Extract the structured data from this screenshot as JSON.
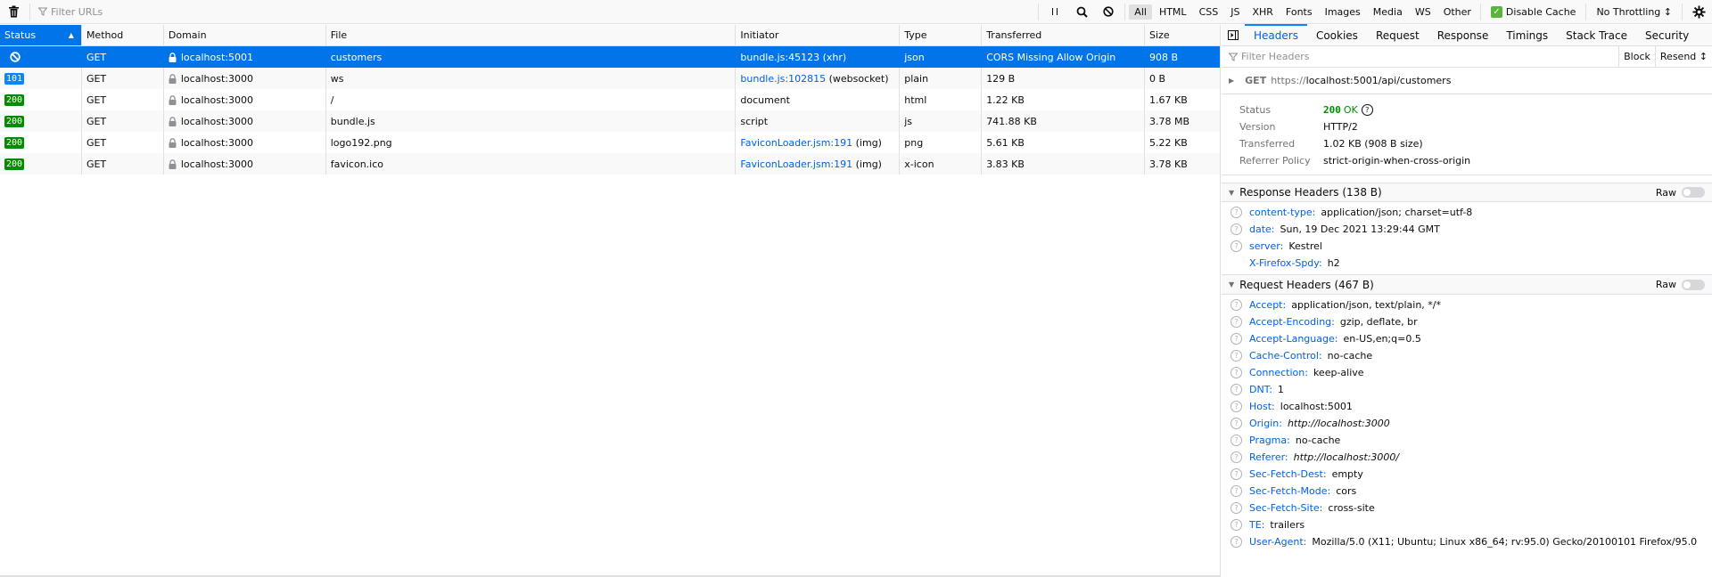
{
  "toolbar": {
    "filter_placeholder": "Filter URLs",
    "type_filters": [
      "All",
      "HTML",
      "CSS",
      "JS",
      "XHR",
      "Fonts",
      "Images",
      "Media",
      "WS",
      "Other"
    ],
    "active_filter": "All",
    "disable_cache_label": "Disable Cache",
    "disable_cache_checked": true,
    "throttling_label": "No Throttling ↕"
  },
  "table": {
    "columns": [
      "Status",
      "Method",
      "Domain",
      "File",
      "Initiator",
      "Type",
      "Transferred",
      "Size"
    ],
    "sorted_column": "Status",
    "rows": [
      {
        "status": "blocked",
        "status_color": "",
        "method": "GET",
        "domain": "localhost:5001",
        "file": "customers",
        "initiator_link": "bundle.js:45123",
        "initiator_extra": " (xhr)",
        "type": "json",
        "transferred": "CORS Missing Allow Origin",
        "size": "908 B",
        "selected": true
      },
      {
        "status": "101",
        "status_color": "#0a84ff",
        "method": "GET",
        "domain": "localhost:3000",
        "file": "ws",
        "initiator_link": "bundle.js:102815",
        "initiator_extra": " (websocket)",
        "type": "plain",
        "transferred": "129 B",
        "size": "0 B",
        "selected": false
      },
      {
        "status": "200",
        "status_color": "#058b00",
        "method": "GET",
        "domain": "localhost:3000",
        "file": "/",
        "initiator_link": "",
        "initiator_extra": "document",
        "type": "html",
        "transferred": "1.22 KB",
        "size": "1.67 KB",
        "selected": false
      },
      {
        "status": "200",
        "status_color": "#058b00",
        "method": "GET",
        "domain": "localhost:3000",
        "file": "bundle.js",
        "initiator_link": "",
        "initiator_extra": "script",
        "type": "js",
        "transferred": "741.88 KB",
        "size": "3.78 MB",
        "selected": false
      },
      {
        "status": "200",
        "status_color": "#058b00",
        "method": "GET",
        "domain": "localhost:3000",
        "file": "logo192.png",
        "initiator_link": "FaviconLoader.jsm:191",
        "initiator_extra": " (img)",
        "type": "png",
        "transferred": "5.61 KB",
        "size": "5.22 KB",
        "selected": false
      },
      {
        "status": "200",
        "status_color": "#058b00",
        "method": "GET",
        "domain": "localhost:3000",
        "file": "favicon.ico",
        "initiator_link": "FaviconLoader.jsm:191",
        "initiator_extra": " (img)",
        "type": "x-icon",
        "transferred": "3.83 KB",
        "size": "3.78 KB",
        "selected": false
      }
    ]
  },
  "panel": {
    "tabs": [
      "Headers",
      "Cookies",
      "Request",
      "Response",
      "Timings",
      "Stack Trace",
      "Security"
    ],
    "active_tab": "Headers",
    "filter_placeholder": "Filter Headers",
    "block_label": "Block",
    "resend_label": "Resend ↕",
    "request_method": "GET",
    "request_url_scheme": "https://",
    "request_url_rest": "localhost:5001/api/customers",
    "summary": {
      "status_label": "Status",
      "status_code": "200",
      "status_text": "OK",
      "version_label": "Version",
      "version": "HTTP/2",
      "transferred_label": "Transferred",
      "transferred": "1.02 KB (908 B size)",
      "referrer_label": "Referrer Policy",
      "referrer": "strict-origin-when-cross-origin"
    },
    "response_headers": {
      "title": "Response Headers (138 B)",
      "raw_label": "Raw",
      "items": [
        {
          "name": "content-type:",
          "value": "application/json; charset=utf-8",
          "help": true,
          "italic": false
        },
        {
          "name": "date:",
          "value": "Sun, 19 Dec 2021 13:29:44 GMT",
          "help": true,
          "italic": false
        },
        {
          "name": "server:",
          "value": "Kestrel",
          "help": true,
          "italic": false
        },
        {
          "name": "X-Firefox-Spdy:",
          "value": "h2",
          "help": false,
          "italic": false
        }
      ]
    },
    "request_headers": {
      "title": "Request Headers (467 B)",
      "raw_label": "Raw",
      "items": [
        {
          "name": "Accept:",
          "value": "application/json, text/plain, */*",
          "help": true,
          "italic": false
        },
        {
          "name": "Accept-Encoding:",
          "value": "gzip, deflate, br",
          "help": true,
          "italic": false
        },
        {
          "name": "Accept-Language:",
          "value": "en-US,en;q=0.5",
          "help": true,
          "italic": false
        },
        {
          "name": "Cache-Control:",
          "value": "no-cache",
          "help": true,
          "italic": false
        },
        {
          "name": "Connection:",
          "value": "keep-alive",
          "help": true,
          "italic": false
        },
        {
          "name": "DNT:",
          "value": "1",
          "help": true,
          "italic": false
        },
        {
          "name": "Host:",
          "value": "localhost:5001",
          "help": true,
          "italic": false
        },
        {
          "name": "Origin:",
          "value": "http://localhost:3000",
          "help": true,
          "italic": true
        },
        {
          "name": "Pragma:",
          "value": "no-cache",
          "help": true,
          "italic": false
        },
        {
          "name": "Referer:",
          "value": "http://localhost:3000/",
          "help": true,
          "italic": true
        },
        {
          "name": "Sec-Fetch-Dest:",
          "value": "empty",
          "help": true,
          "italic": false
        },
        {
          "name": "Sec-Fetch-Mode:",
          "value": "cors",
          "help": true,
          "italic": false
        },
        {
          "name": "Sec-Fetch-Site:",
          "value": "cross-site",
          "help": true,
          "italic": false
        },
        {
          "name": "TE:",
          "value": "trailers",
          "help": true,
          "italic": false
        },
        {
          "name": "User-Agent:",
          "value": "Mozilla/5.0 (X11; Ubuntu; Linux x86_64; rv:95.0) Gecko/20100101 Firefox/95.0",
          "help": true,
          "italic": false
        }
      ]
    }
  }
}
